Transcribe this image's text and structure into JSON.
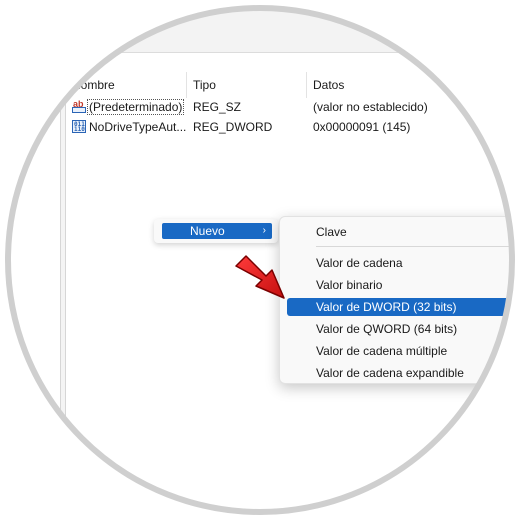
{
  "columns": {
    "name": "Nombre",
    "type": "Tipo",
    "data": "Datos"
  },
  "values": [
    {
      "name": "(Predeterminado)",
      "type": "REG_SZ",
      "data": "(valor no establecido)",
      "icon": "string-value-icon"
    },
    {
      "name": "NoDriveTypeAut...",
      "type": "REG_DWORD",
      "data": "0x00000091 (145)",
      "icon": "binary-value-icon"
    }
  ],
  "context_menu": {
    "item": "Nuevo",
    "arrow": "›"
  },
  "submenu": {
    "items": [
      {
        "label": "Clave"
      },
      {
        "label": "Valor de cadena"
      },
      {
        "label": "Valor binario"
      },
      {
        "label": "Valor de DWORD (32 bits)",
        "highlighted": true
      },
      {
        "label": "Valor de QWORD (64 bits)"
      },
      {
        "label": "Valor de cadena múltiple"
      },
      {
        "label": "Valor de cadena expandible"
      }
    ]
  },
  "colors": {
    "highlight": "#1969c4",
    "arrow": "#e02020"
  },
  "icons": {
    "ab": "ab",
    "bin": [
      "011",
      "110"
    ]
  }
}
